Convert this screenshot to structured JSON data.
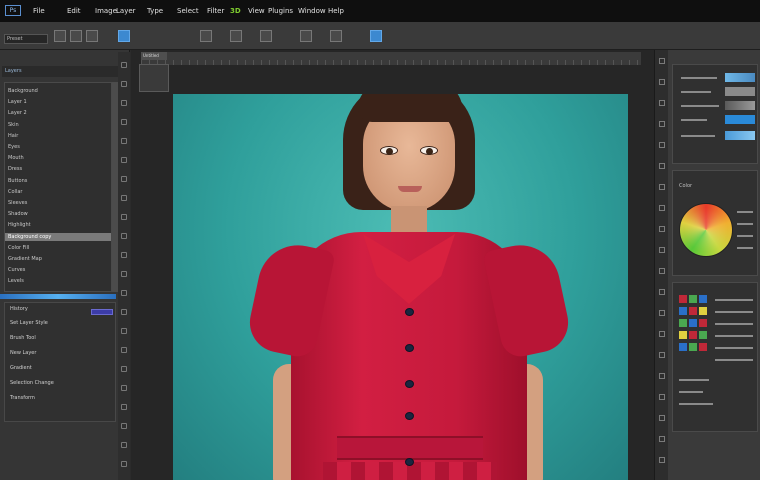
{
  "app": {
    "logo_label": "Ps",
    "menu": [
      "File",
      "Edit",
      "Image",
      "Layer",
      "Type",
      "Select",
      "Filter",
      "3D",
      "View",
      "Plugins",
      "Window",
      "Help"
    ]
  },
  "options_bar": {
    "preset_label": "Preset"
  },
  "document": {
    "tab_label": "Untitled"
  },
  "layers_panel": {
    "title": "Layers",
    "layers": [
      "Background",
      "Layer 1",
      "Layer 2",
      "Skin",
      "Hair",
      "Eyes",
      "Mouth",
      "Dress",
      "Buttons",
      "Collar",
      "Sleeves",
      "Shadow",
      "Highlight",
      "Background copy",
      "Color Fill",
      "Gradient Map",
      "Curves",
      "Levels"
    ],
    "selected_index": 13
  },
  "history_panel": {
    "title": "History",
    "items": [
      "Set Layer Style",
      "Brush Tool",
      "New Layer",
      "Gradient",
      "Selection Change",
      "Transform"
    ]
  },
  "color_panel": {
    "title": "Color"
  },
  "colors": {
    "accent_blue": "#3c89d0",
    "canvas_teal": "#2f9f9b",
    "dress_red": "#c51a3c",
    "hair_brown": "#3a2218"
  },
  "icons": {
    "menu_logo": "app-logo-icon",
    "move_tool": "move-tool-icon",
    "eye": "visibility-eye-icon"
  }
}
